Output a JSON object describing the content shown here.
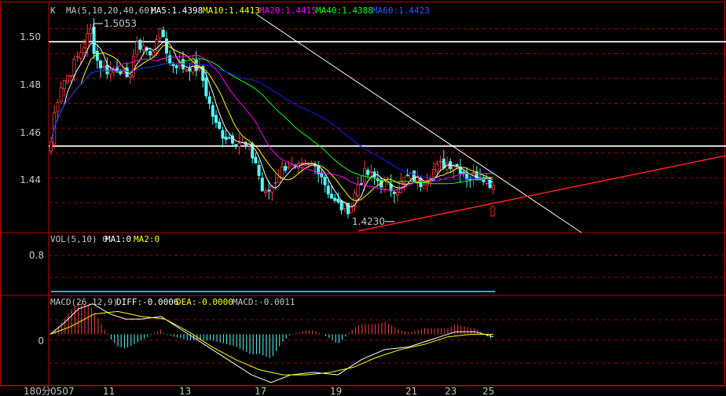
{
  "header": {
    "k_label": "K",
    "ma_params": "MA(5,10,20,40,60)",
    "ma5": "MA5:1.4398",
    "ma10": "MA10:1.4413",
    "ma20": "MA20:1.4415",
    "ma40": "MA40:1.4388",
    "ma60": "MA60:1.4423"
  },
  "volume_panel": {
    "label": "VOL(5,10) 0",
    "ma1": "MA1:0",
    "ma2": "MA2:0",
    "tick": "0.8"
  },
  "macd_panel": {
    "label": "MACD(26,12,9)",
    "diff": "DIFF:-0.0006",
    "dea": "DEA:-0.0000",
    "macd": "MACD:-0.0011",
    "tick": "0"
  },
  "annotations": {
    "high": "1.5053",
    "low": "1.4230"
  },
  "x_axis": {
    "corner": "180分",
    "ticks": [
      "0507",
      "11",
      "13",
      "17",
      "19",
      "21",
      "23",
      "25"
    ]
  },
  "colors": {
    "up": "#ff4040",
    "down": "#54fcfc",
    "ma5": "#ffffff",
    "ma10": "#ffff00",
    "ma20": "#ff00ff",
    "ma40": "#00ff00",
    "ma60": "#1818ff",
    "grid": "#a00000",
    "frame": "#c00000",
    "support": "#ff2020",
    "resistance": "#ffffff"
  },
  "chart_data": {
    "type": "candlestick",
    "price_axis": {
      "ticks": [
        1.5,
        1.48,
        1.46,
        1.44
      ],
      "ylim": [
        1.418,
        1.51
      ]
    },
    "volume_axis": {
      "ticks": [
        0.8
      ],
      "ylim": [
        0,
        1.0
      ]
    },
    "macd_axis": {
      "ticks": [
        0
      ],
      "ylim": [
        -0.02,
        0.015
      ]
    },
    "highest": 1.5053,
    "lowest": 1.423,
    "horizontal_levels": [
      1.4948,
      1.4528
    ],
    "x_labels": [
      "0507",
      "11",
      "13",
      "17",
      "19",
      "21",
      "23",
      "25"
    ]
  }
}
